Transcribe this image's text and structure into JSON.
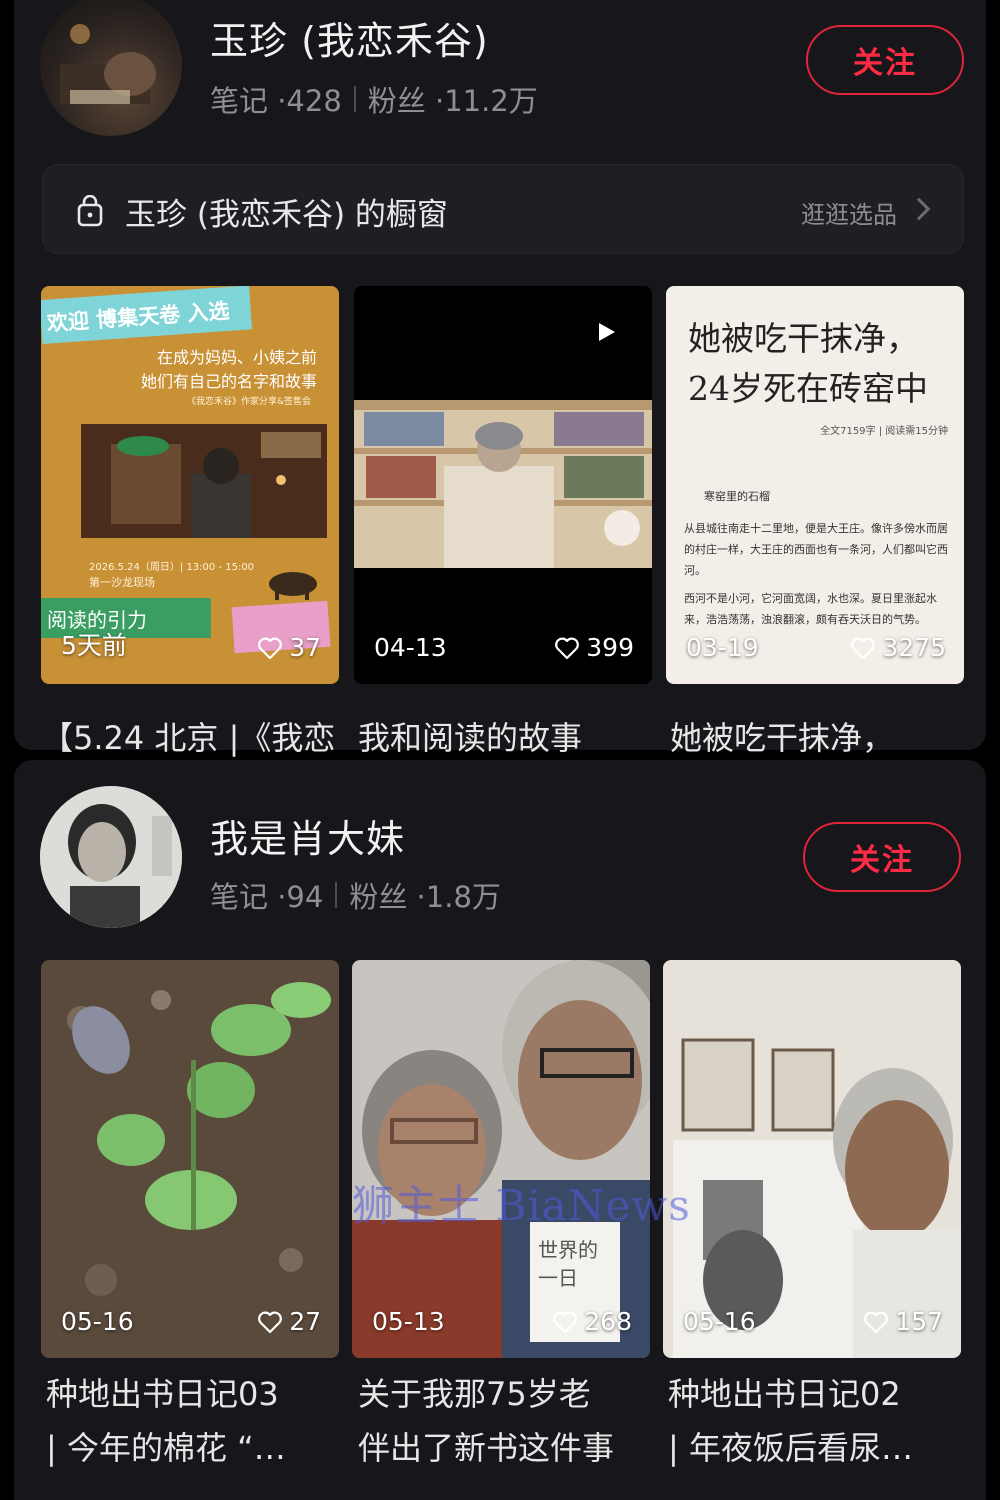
{
  "creators": [
    {
      "name": "玉珍 (我恋禾谷)",
      "notes_label": "笔记 ·428",
      "fans_label": "粉丝 ·11.2万",
      "follow_label": "关注",
      "shop": {
        "title": "玉珍 (我恋禾谷) 的橱窗",
        "browse_label": "逛逛选品"
      },
      "posts": [
        {
          "date": "5天前",
          "likes": "37",
          "caption": "【5.24 北京 |《我恋",
          "poster_banner": "欢迎 博集天卷 入选",
          "poster_line1": "在成为妈妈、小姨之前",
          "poster_line2": "她们有自己的名字和故事",
          "poster_sub": "《我恋禾谷》作家分享&签售会",
          "poster_date": "2026.5.24（周日）| 13:00 - 15:00",
          "poster_venue": "第一沙龙现场",
          "poster_bottom": "阅读的引力"
        },
        {
          "date": "04-13",
          "likes": "399",
          "caption": "我和阅读的故事"
        },
        {
          "date": "03-19",
          "likes": "3275",
          "caption": "她被吃干抹净，",
          "paper_title1": "她被吃干抹净，",
          "paper_title2": "24岁死在砖窑中",
          "paper_meta": "全文7159字 | 阅读需15分钟",
          "paper_section": "寒窑里的石榴",
          "paper_p1": "从县城往南走十二里地，便是大王庄。像许多傍水而居的村庄一样，大王庄的西面也有一条河，人们都叫它西河。",
          "paper_p2": "西河不是小河，它河面宽阔，水也深。夏日里涨起水来，浩浩荡荡，浊浪翻滚，颇有吞天沃日的气势。"
        }
      ]
    },
    {
      "name": "我是肖大妹",
      "notes_label": "笔记 ·94",
      "fans_label": "粉丝 ·1.8万",
      "follow_label": "关注",
      "posts": [
        {
          "date": "05-16",
          "likes": "27",
          "caption_line1": "种地出书日记03",
          "caption_line2": "| 今年的棉花 “…"
        },
        {
          "date": "05-13",
          "likes": "268",
          "caption_line1": "关于我那75岁老",
          "caption_line2": "伴出了新书这件事",
          "book_text": "世界的一日"
        },
        {
          "date": "05-16",
          "likes": "157",
          "caption_line1": "种地出书日记02",
          "caption_line2": "| 年夜饭后看尿…"
        }
      ]
    }
  ],
  "watermark": "狮主士 BiaNews",
  "colors": {
    "follow_red": "#ff2b45",
    "card_bg": "#16161b",
    "page_bg": "#000000"
  }
}
